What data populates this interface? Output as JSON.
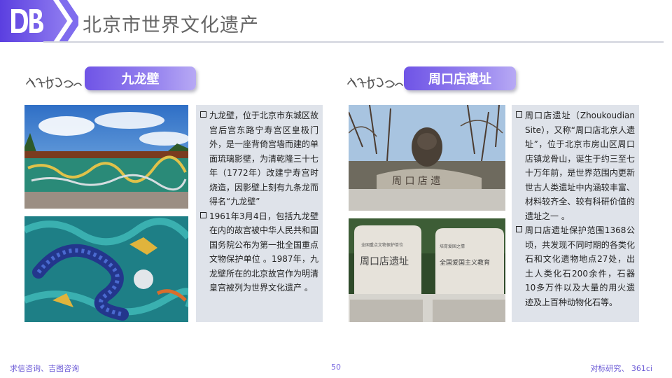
{
  "header": {
    "title": "北京市世界文化遗产",
    "accent": "#6f54e6"
  },
  "sections": [
    {
      "tag_icon": "culture-heritage-calligraphy",
      "title": "九龙壁",
      "photos": [
        "nine-dragon-wall-photo",
        "dragon-relief-closeup-photo"
      ],
      "paragraphs": [
        "九龙壁，位于北京市东城区故宫后宫东路宁寿宫区皇极门外，是一座背倚宫墙而建的单面琉璃影壁，为清乾隆三十七年（1772年）改建宁寿宫时烧造，因影壁上刻有九条龙而得名“九龙壁”",
        "1961年3月4日，包括九龙壁在内的故宫被中华人民共和国国务院公布为第一批全国重点文物保护单位 。1987年，九龙壁所在的北京故宫作为明清皇宫被列为世界文化遗产 。"
      ]
    },
    {
      "tag_icon": "culture-heritage-calligraphy",
      "title": "周口店遗址",
      "photos": [
        "peking-man-statue-photo",
        "zhoukoudian-stele-photo"
      ],
      "paragraphs": [
        "周口店遗址（Zhoukoudian Site），又称“周口店北京人遗址”，位于北京市房山区周口店镇龙骨山，诞生于约三至七十万年前，是世界范围内更新世古人类遗址中内涵较丰富、材料较齐全、较有科研价值的遗址之一 。",
        "周口店遗址保护范围1368公顷，共发现不同时期的各类化石和文化遗物地点27处，出土人类化石200余件，石器10多万件以及大量的用火遗迹及上百种动物化石等。"
      ]
    }
  ],
  "footer": {
    "left": "求信咨询、吉图咨询",
    "page": "50",
    "right": "对标研究、 361ci"
  }
}
